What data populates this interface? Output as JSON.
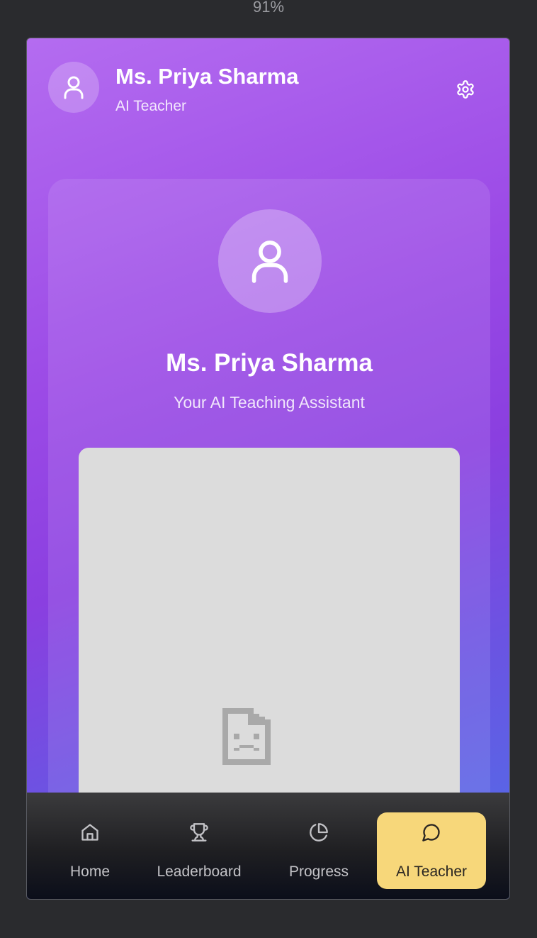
{
  "zoom": "91%",
  "header": {
    "name": "Ms. Priya Sharma",
    "role": "AI Teacher"
  },
  "profile_card": {
    "name": "Ms. Priya Sharma",
    "subtitle": "Your AI Teaching Assistant"
  },
  "bottom_nav": {
    "items": [
      {
        "label": "Home",
        "icon": "home-icon"
      },
      {
        "label": "Leaderboard",
        "icon": "trophy-icon"
      },
      {
        "label": "Progress",
        "icon": "pie-chart-icon"
      },
      {
        "label": "AI Teacher",
        "icon": "chat-bubble-icon",
        "active": true
      }
    ]
  },
  "colors": {
    "gradient_start": "#b46cf0",
    "gradient_mid": "#8a3fe0",
    "gradient_end": "#4f6fe8",
    "active_tab": "#f7d77a",
    "nav_bg": "#1f1f22"
  }
}
